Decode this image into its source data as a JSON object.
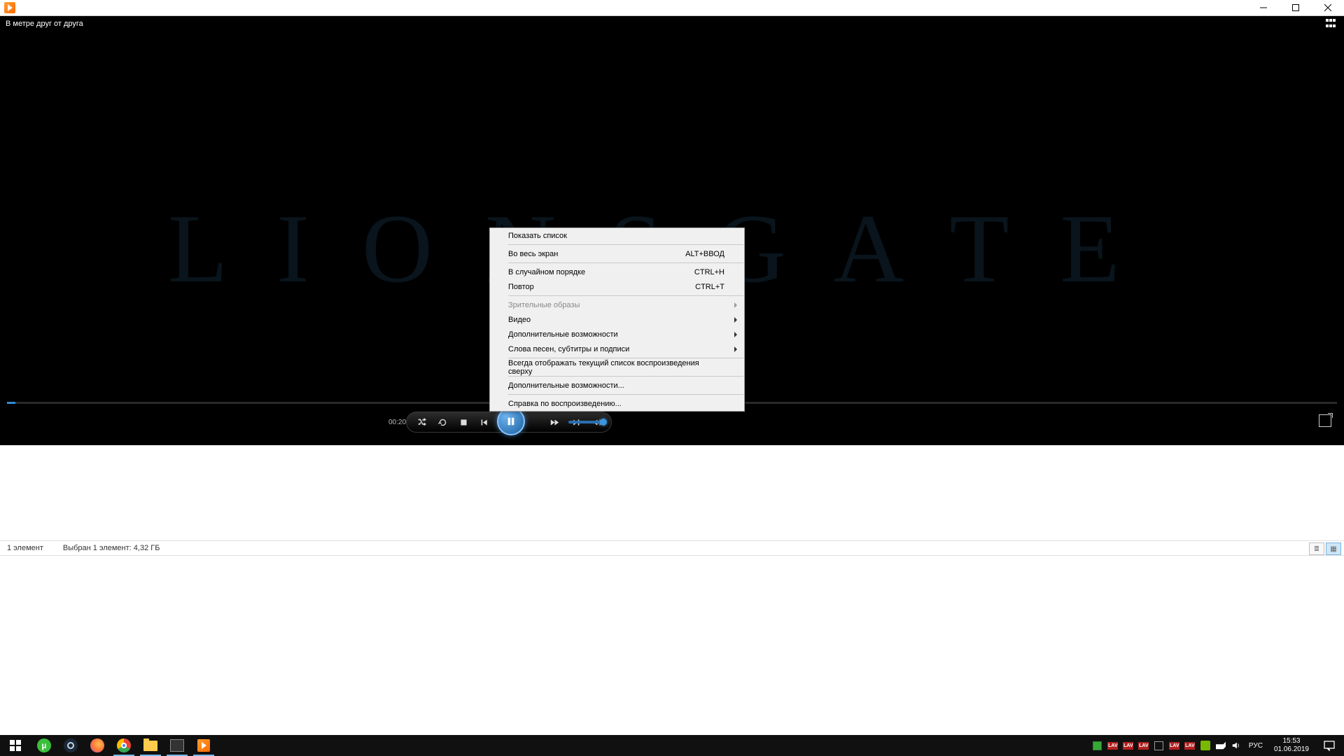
{
  "titlebar": {
    "app_icon": "wmp-icon"
  },
  "player": {
    "now_playing_title": "В метре друг от друга",
    "ghost_studio_text": "L I O N S G A T E",
    "elapsed_time": "00:20"
  },
  "context_menu": {
    "items": [
      {
        "label": "Показать список",
        "shortcut": "",
        "submenu": false,
        "disabled": false,
        "sep_after": true
      },
      {
        "label": "Во весь экран",
        "shortcut": "ALT+ВВОД",
        "submenu": false,
        "disabled": false,
        "sep_after": true
      },
      {
        "label": "В случайном порядке",
        "shortcut": "CTRL+H",
        "submenu": false,
        "disabled": false,
        "sep_after": false
      },
      {
        "label": "Повтор",
        "shortcut": "CTRL+T",
        "submenu": false,
        "disabled": false,
        "sep_after": true
      },
      {
        "label": "Зрительные образы",
        "shortcut": "",
        "submenu": true,
        "disabled": true,
        "sep_after": false
      },
      {
        "label": "Видео",
        "shortcut": "",
        "submenu": true,
        "disabled": false,
        "sep_after": false
      },
      {
        "label": "Дополнительные возможности",
        "shortcut": "",
        "submenu": true,
        "disabled": false,
        "sep_after": false
      },
      {
        "label": "Слова песен, субтитры и подписи",
        "shortcut": "",
        "submenu": true,
        "disabled": false,
        "sep_after": true
      },
      {
        "label": "Всегда отображать текущий список воспроизведения сверху",
        "shortcut": "",
        "submenu": false,
        "disabled": false,
        "sep_after": true
      },
      {
        "label": "Дополнительные возможности...",
        "shortcut": "",
        "submenu": false,
        "disabled": false,
        "sep_after": true
      },
      {
        "label": "Справка по воспроизведению...",
        "shortcut": "",
        "submenu": false,
        "disabled": false,
        "sep_after": false
      }
    ]
  },
  "explorer_status": {
    "count_text": "1 элемент",
    "selection_text": "Выбран 1 элемент: 4,32 ГБ"
  },
  "taskbar": {
    "apps": [
      {
        "name": "start",
        "color": "",
        "active": false
      },
      {
        "name": "utorrent",
        "color": "#3bbf3b",
        "active": false
      },
      {
        "name": "steam",
        "color": "#1b2838",
        "active": false
      },
      {
        "name": "firefox",
        "color": "#ff7139",
        "active": false
      },
      {
        "name": "chrome",
        "color": "#4285f4",
        "active": true
      },
      {
        "name": "explorer",
        "color": "#ffcc4d",
        "active": true
      },
      {
        "name": "movies",
        "color": "#444444",
        "active": true
      },
      {
        "name": "wmp",
        "color": "#ff7a00",
        "active": true
      }
    ],
    "tray": {
      "lang": "РУС",
      "time": "15:53",
      "date": "01.06.2019"
    }
  }
}
